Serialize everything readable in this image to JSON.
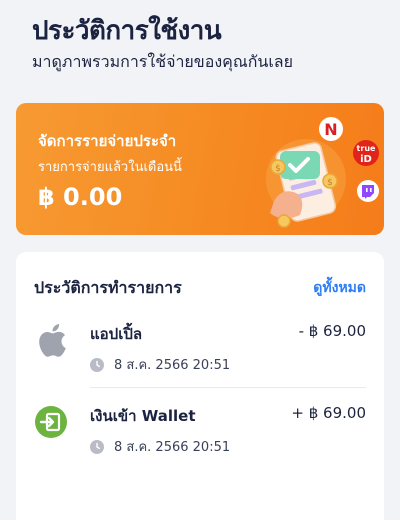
{
  "header": {
    "title": "ประวัติการใช้งาน",
    "subtitle": "มาดูภาพรวมการใช้จ่ายของคุณกันเลย"
  },
  "banner": {
    "title": "จัดการรายจ่ายประจำ",
    "subtitle": "รายการจ่ายแล้วในเดือนนี้",
    "amount": "฿ 0.00",
    "color": "#f68a22",
    "service_icons": [
      "netflix-icon",
      "trueid-icon",
      "twitch-icon"
    ],
    "badge_texts": {
      "netflix": "N",
      "trueid": "true iD"
    }
  },
  "history": {
    "title": "ประวัติการทำรายการ",
    "see_all": "ดูทั้งหมด",
    "items": [
      {
        "name": "แอปเปิ้ล",
        "amount": "- ฿ 69.00",
        "datetime": "8 ส.ค. 2566 20:51",
        "icon": "apple-icon"
      },
      {
        "name": "เงินเข้า Wallet",
        "amount": "+ ฿ 69.00",
        "datetime": "8 ส.ค. 2566 20:51",
        "icon": "wallet-topup-icon"
      }
    ]
  },
  "colors": {
    "accent_link": "#2d7df6",
    "wallet_green": "#6cb33f",
    "text": "#1b2340"
  }
}
